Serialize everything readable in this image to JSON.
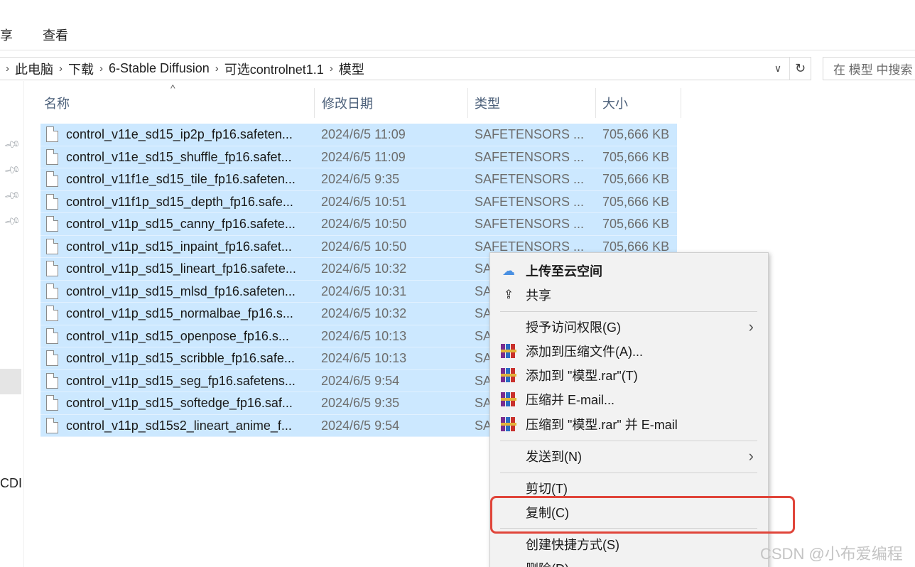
{
  "ribbon": {
    "share_tab": "享",
    "view_tab": "查看"
  },
  "address": {
    "crumbs": [
      "此电脑",
      "下载",
      "6-Stable Diffusion",
      "可选controlnet1.1",
      "模型"
    ],
    "dropdown_icon": "chevron-down-icon",
    "refresh_icon": "refresh-icon"
  },
  "search": {
    "placeholder": "在 模型 中搜索"
  },
  "nav": {
    "partial_label": "CDI"
  },
  "columns": {
    "name": "名称",
    "date": "修改日期",
    "type": "类型",
    "size": "大小"
  },
  "files": [
    {
      "name": "control_v11e_sd15_ip2p_fp16.safeten...",
      "date": "2024/6/5 11:09",
      "type": "SAFETENSORS ...",
      "size": "705,666 KB"
    },
    {
      "name": "control_v11e_sd15_shuffle_fp16.safet...",
      "date": "2024/6/5 11:09",
      "type": "SAFETENSORS ...",
      "size": "705,666 KB"
    },
    {
      "name": "control_v11f1e_sd15_tile_fp16.safeten...",
      "date": "2024/6/5 9:35",
      "type": "SAFETENSORS ...",
      "size": "705,666 KB"
    },
    {
      "name": "control_v11f1p_sd15_depth_fp16.safe...",
      "date": "2024/6/5 10:51",
      "type": "SAFETENSORS ...",
      "size": "705,666 KB"
    },
    {
      "name": "control_v11p_sd15_canny_fp16.safete...",
      "date": "2024/6/5 10:50",
      "type": "SAFETENSORS ...",
      "size": "705,666 KB"
    },
    {
      "name": "control_v11p_sd15_inpaint_fp16.safet...",
      "date": "2024/6/5 10:50",
      "type": "SAFETENSORS ...",
      "size": "705,666 KB"
    },
    {
      "name": "control_v11p_sd15_lineart_fp16.safete...",
      "date": "2024/6/5 10:32",
      "type": "SA",
      "size": ""
    },
    {
      "name": "control_v11p_sd15_mlsd_fp16.safeten...",
      "date": "2024/6/5 10:31",
      "type": "SA",
      "size": ""
    },
    {
      "name": "control_v11p_sd15_normalbae_fp16.s...",
      "date": "2024/6/5 10:32",
      "type": "SA",
      "size": ""
    },
    {
      "name": "control_v11p_sd15_openpose_fp16.s...",
      "date": "2024/6/5 10:13",
      "type": "SA",
      "size": ""
    },
    {
      "name": "control_v11p_sd15_scribble_fp16.safe...",
      "date": "2024/6/5 10:13",
      "type": "SA",
      "size": ""
    },
    {
      "name": "control_v11p_sd15_seg_fp16.safetens...",
      "date": "2024/6/5 9:54",
      "type": "SA",
      "size": ""
    },
    {
      "name": "control_v11p_sd15_softedge_fp16.saf...",
      "date": "2024/6/5 9:35",
      "type": "SA",
      "size": ""
    },
    {
      "name": "control_v11p_sd15s2_lineart_anime_f...",
      "date": "2024/6/5 9:54",
      "type": "SA",
      "size": ""
    }
  ],
  "context_menu": {
    "upload": "上传至云空间",
    "share": "共享",
    "grant_access": "授予访问权限(G)",
    "add_archive": "添加到压缩文件(A)...",
    "add_rar": "添加到 \"模型.rar\"(T)",
    "compress_email": "压缩并 E-mail...",
    "compress_rar_email": "压缩到 \"模型.rar\" 并 E-mail",
    "send_to": "发送到(N)",
    "cut": "剪切(T)",
    "copy": "复制(C)",
    "create_shortcut": "创建快捷方式(S)",
    "delete_partial": "删除(D)"
  },
  "colors": {
    "selection": "#cce8ff",
    "highlight": "#e0453a",
    "menu_bg": "#f2f2f2"
  },
  "watermark": "CSDN @小布爱编程"
}
